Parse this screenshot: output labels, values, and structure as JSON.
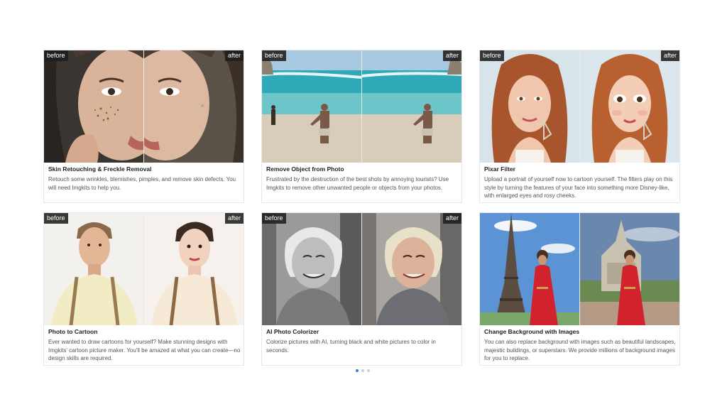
{
  "cards": [
    {
      "before_label": "before",
      "after_label": "after",
      "title": "Skin Retouching & Freckle Removal",
      "description": "Retouch some wrinkles, blemishes, pimples, and remove skin defects. You will need Imgkits to help you."
    },
    {
      "before_label": "before",
      "after_label": "after",
      "title": "Remove Object from Photo",
      "description": "Frustrated by the destruction of the best shots by annoying tourists? Use Imgkits to remove other unwanted people or objects from your photos."
    },
    {
      "before_label": "before",
      "after_label": "after",
      "title": "Pixar Filter",
      "description": "Upload a portrait of yourself now to cartoon yourself. The filters play on this style by turning the features of your face into something more Disney-like, with enlarged eyes and rosy cheeks."
    },
    {
      "before_label": "before",
      "after_label": "after",
      "title": "Photo to Cartoon",
      "description": "Ever wanted to draw cartoons for yourself? Make stunning designs with Imgkits' cartoon picture maker. You'll be amazed at what you can create—no design skills are required."
    },
    {
      "before_label": "before",
      "after_label": "after",
      "title": "AI Photo Colorizer",
      "description": "Colorize pictures with AI, turning black and white pictures to color in seconds."
    },
    {
      "title": "Change Background with Images",
      "description": "You can also replace background with images such as beautiful landscapes, majestic buildings, or superstars. We provide millions of background images for you to replace."
    }
  ],
  "pagination": {
    "count": 3,
    "active_index": 0
  },
  "colors": {
    "accent": "#2b7fe0",
    "tag_bg": "#1e1e1e"
  }
}
